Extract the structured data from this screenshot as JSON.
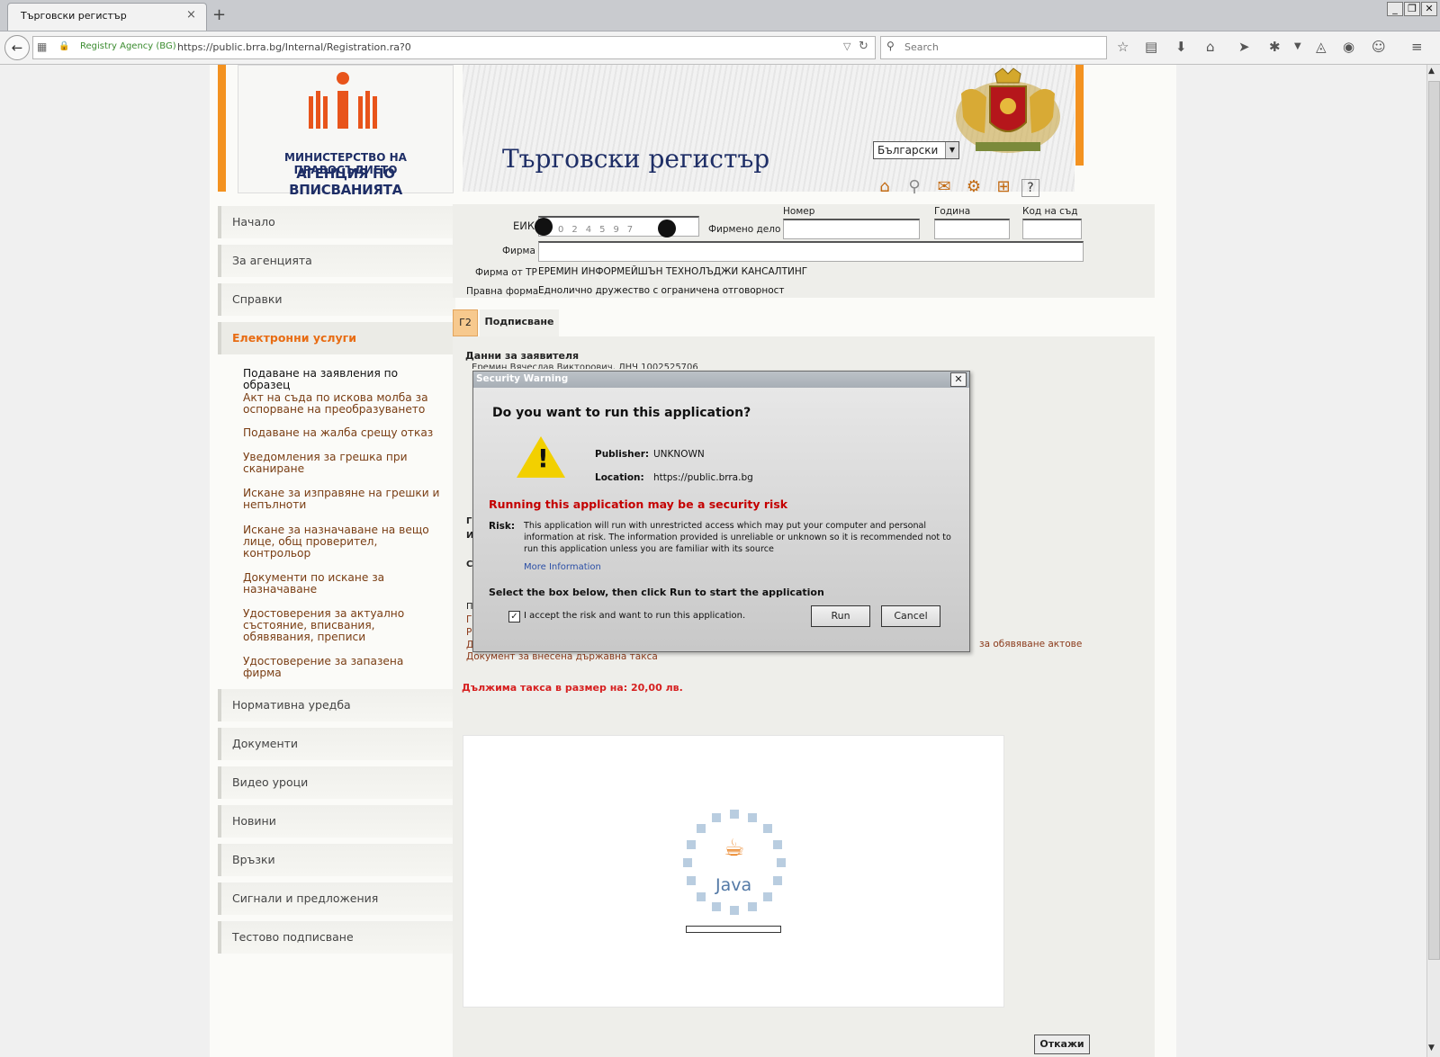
{
  "browser": {
    "tab_title": "Търговски регистър",
    "tab_close": "×",
    "new_tab": "+",
    "site_identity": "Registry Agency (BG)",
    "url": "https://public.brra.bg/Internal/Registration.ra?0",
    "search_placeholder": "Search",
    "window_controls": [
      "_",
      "❐",
      "✕"
    ]
  },
  "header": {
    "ministry": "МИНИСТЕРСТВО НА ПРАВОСЪДИЕТО",
    "agency": "АГЕНЦИЯ ПО ВПИСВАНИЯТА",
    "site_title": "Търговски регистър",
    "language": "Български"
  },
  "sidebar": {
    "items": [
      "Начало",
      "За агенцията",
      "Справки"
    ],
    "eservices": "Електронни услуги",
    "sub_items": [
      "Подаване на заявления по образец",
      "Акт на съда по искова молба за оспорване на преобразуването",
      "Подаване на жалба срещу отказ",
      "Уведомления за грешка при сканиране",
      "Искане за изправяне на грешки и непълноти",
      "Искане за назначаване на вещо лице, общ проверител, контрольор",
      "Документи по искане за назначаване",
      "Удостоверения за актуално състояние, вписвания, обявявания, преписи",
      "Удостоверение за запазена фирма"
    ],
    "items_after": [
      "Нормативна уредба",
      "Документи",
      "Видео уроци",
      "Новини",
      "Връзки",
      "Сигнали и предложения",
      "Тестово подписване"
    ]
  },
  "form": {
    "eik_label": "ЕИК",
    "eik_digits": "024597",
    "company_case_label": "Фирмено дело",
    "number_label": "Номер",
    "year_label": "Година",
    "court_code_label": "Код на съд",
    "firm_label": "Фирма",
    "firm_tr_label": "Фирма от ТР",
    "firm_tr_value": "ЕРЕМИН ИНФОРМЕЙШЪН ТЕХНОЛЪДЖИ КАНСАЛТИНГ",
    "legal_form_label": "Правна форма",
    "legal_form_value": "Еднолично дружество с ограничена отговорност"
  },
  "tabs": {
    "g2": "Г2",
    "signing": "Подписване"
  },
  "content": {
    "applicant_title": "Данни за заявителя",
    "applicant_name": "Еремин Вячеслав Викторович, ЛНЧ 1002525706",
    "partial_letters": [
      "Г",
      "И",
      "С",
      "П",
      "Г",
      "Р",
      "Д"
    ],
    "link_right": "за обявяване актове",
    "link_fee_doc": "Документ за внесена държавна такса",
    "fee_due": "Дължима такса в размер на: 20,00 лв.",
    "java_label": "Java",
    "cancel_button": "Откажи"
  },
  "dialog": {
    "title": "Security Warning",
    "close": "✕",
    "question": "Do you want to run this application?",
    "publisher_label": "Publisher:",
    "publisher_value": "UNKNOWN",
    "location_label": "Location:",
    "location_value": "https://public.brra.bg",
    "risk_heading": "Running this application may be a security risk",
    "risk_label": "Risk:",
    "risk_text": "This application will run with unrestricted access which may put your computer and personal information at risk. The information provided is unreliable or unknown so it is recommended not to run this application unless you are familiar with its source",
    "more_info": "More Information",
    "select_instruction": "Select the box below, then click Run to start the application",
    "accept_label": "I accept the risk and want to run this application.",
    "accept_checked": true,
    "run_button": "Run",
    "cancel_button": "Cancel"
  },
  "colors": {
    "accent_orange": "#f39220",
    "title_navy": "#1e2e66",
    "eservices_orange": "#e86c13",
    "risk_red": "#c40000",
    "fee_red": "#d62020"
  },
  "icons": [
    "back-icon",
    "lock-icon",
    "reload-icon",
    "search-icon",
    "bookmark-star-icon",
    "reading-list-icon",
    "download-icon",
    "home-icon",
    "send-icon",
    "puzzle-icon",
    "menu-icon",
    "ministry-logo",
    "coat-of-arms",
    "home-tool-icon",
    "search-tool-icon",
    "mail-tool-icon",
    "settings-tool-icon",
    "sitemap-tool-icon",
    "help-tool-icon",
    "warning-icon",
    "java-logo"
  ]
}
